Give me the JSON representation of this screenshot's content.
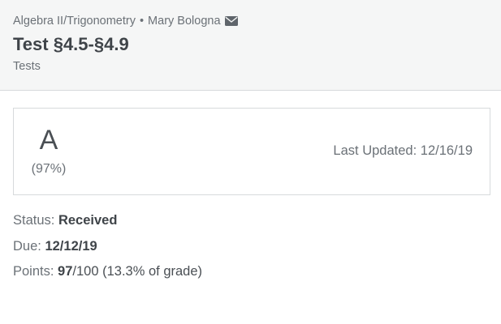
{
  "header": {
    "course": "Algebra II/Trigonometry",
    "separator": "•",
    "teacher": "Mary Bologna",
    "mail_icon": "envelope-icon",
    "title": "Test §4.5-§4.9",
    "category": "Tests"
  },
  "grade": {
    "letter": "A",
    "percent": "(97%)",
    "last_updated_label": "Last Updated:",
    "last_updated_value": "12/16/19"
  },
  "details": {
    "status_label": "Status:",
    "status_value": "Received",
    "due_label": "Due:",
    "due_value": "12/12/19",
    "points_label": "Points:",
    "points_earned": "97",
    "points_rest": "/100 (13.3% of grade)"
  },
  "colors": {
    "header_bg": "#f5f6f6",
    "border": "#d7dadc",
    "text_dark": "#3f4449",
    "text_muted": "#6b7177"
  }
}
